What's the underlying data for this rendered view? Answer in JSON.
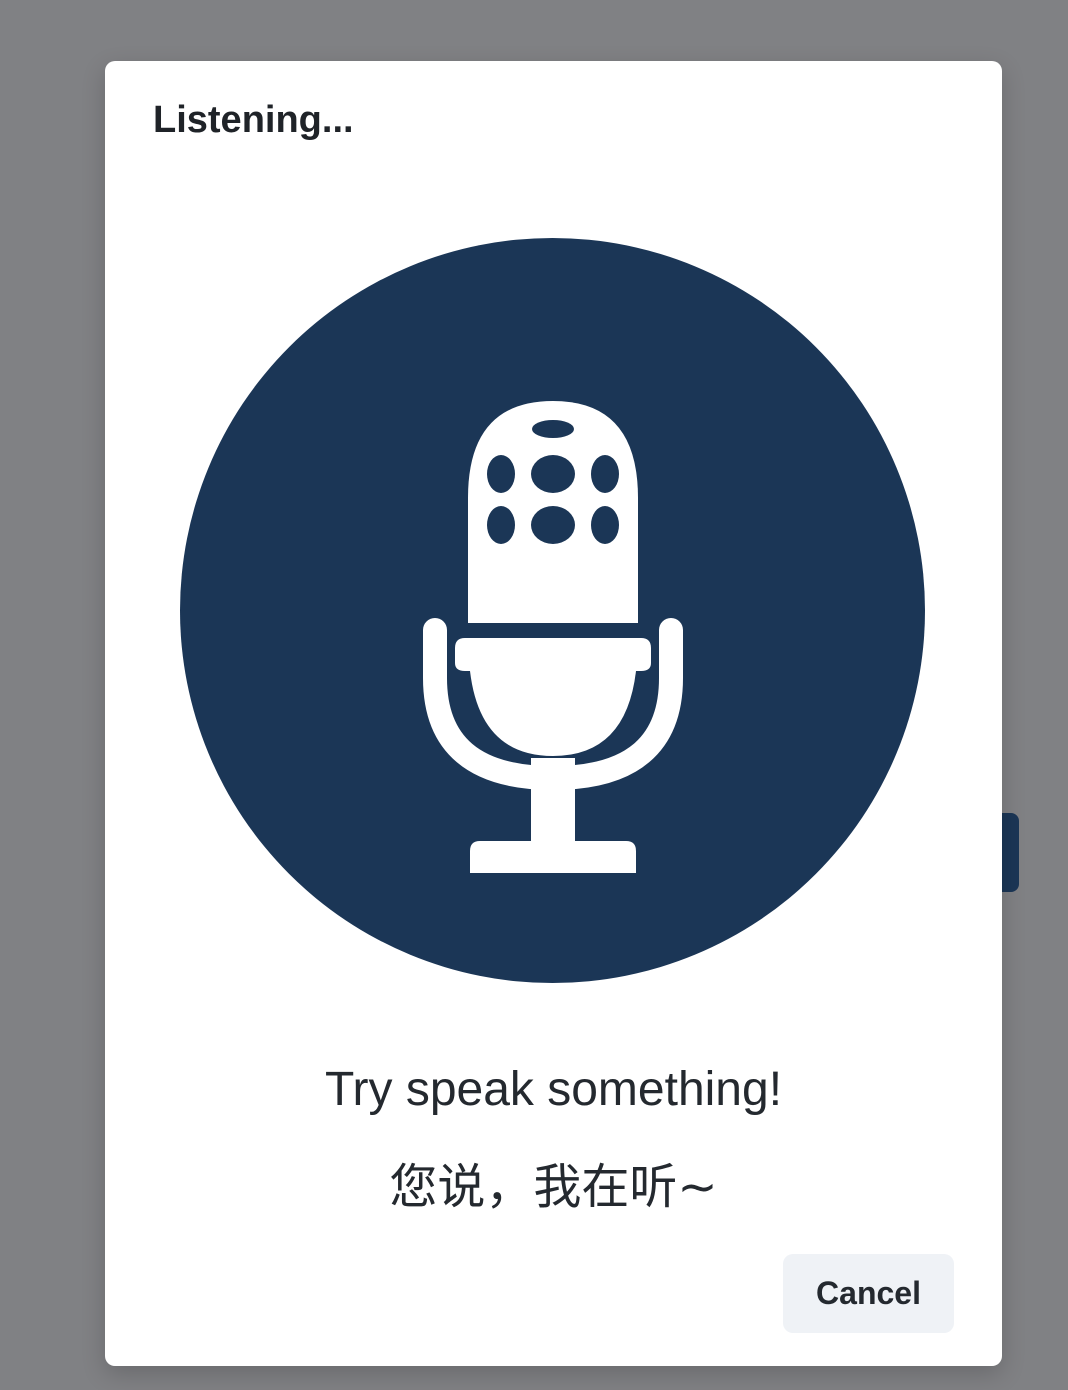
{
  "dialog": {
    "title": "Listening...",
    "prompt_en": "Try speak something!",
    "prompt_zh": "您说，我在听~",
    "cancel_label": "Cancel"
  },
  "icons": {
    "microphone": "microphone-icon"
  },
  "colors": {
    "overlay": "#808184",
    "accent": "#1b3656",
    "dialog_bg": "#ffffff",
    "cancel_bg": "#eff2f6",
    "text": "#24292f"
  }
}
